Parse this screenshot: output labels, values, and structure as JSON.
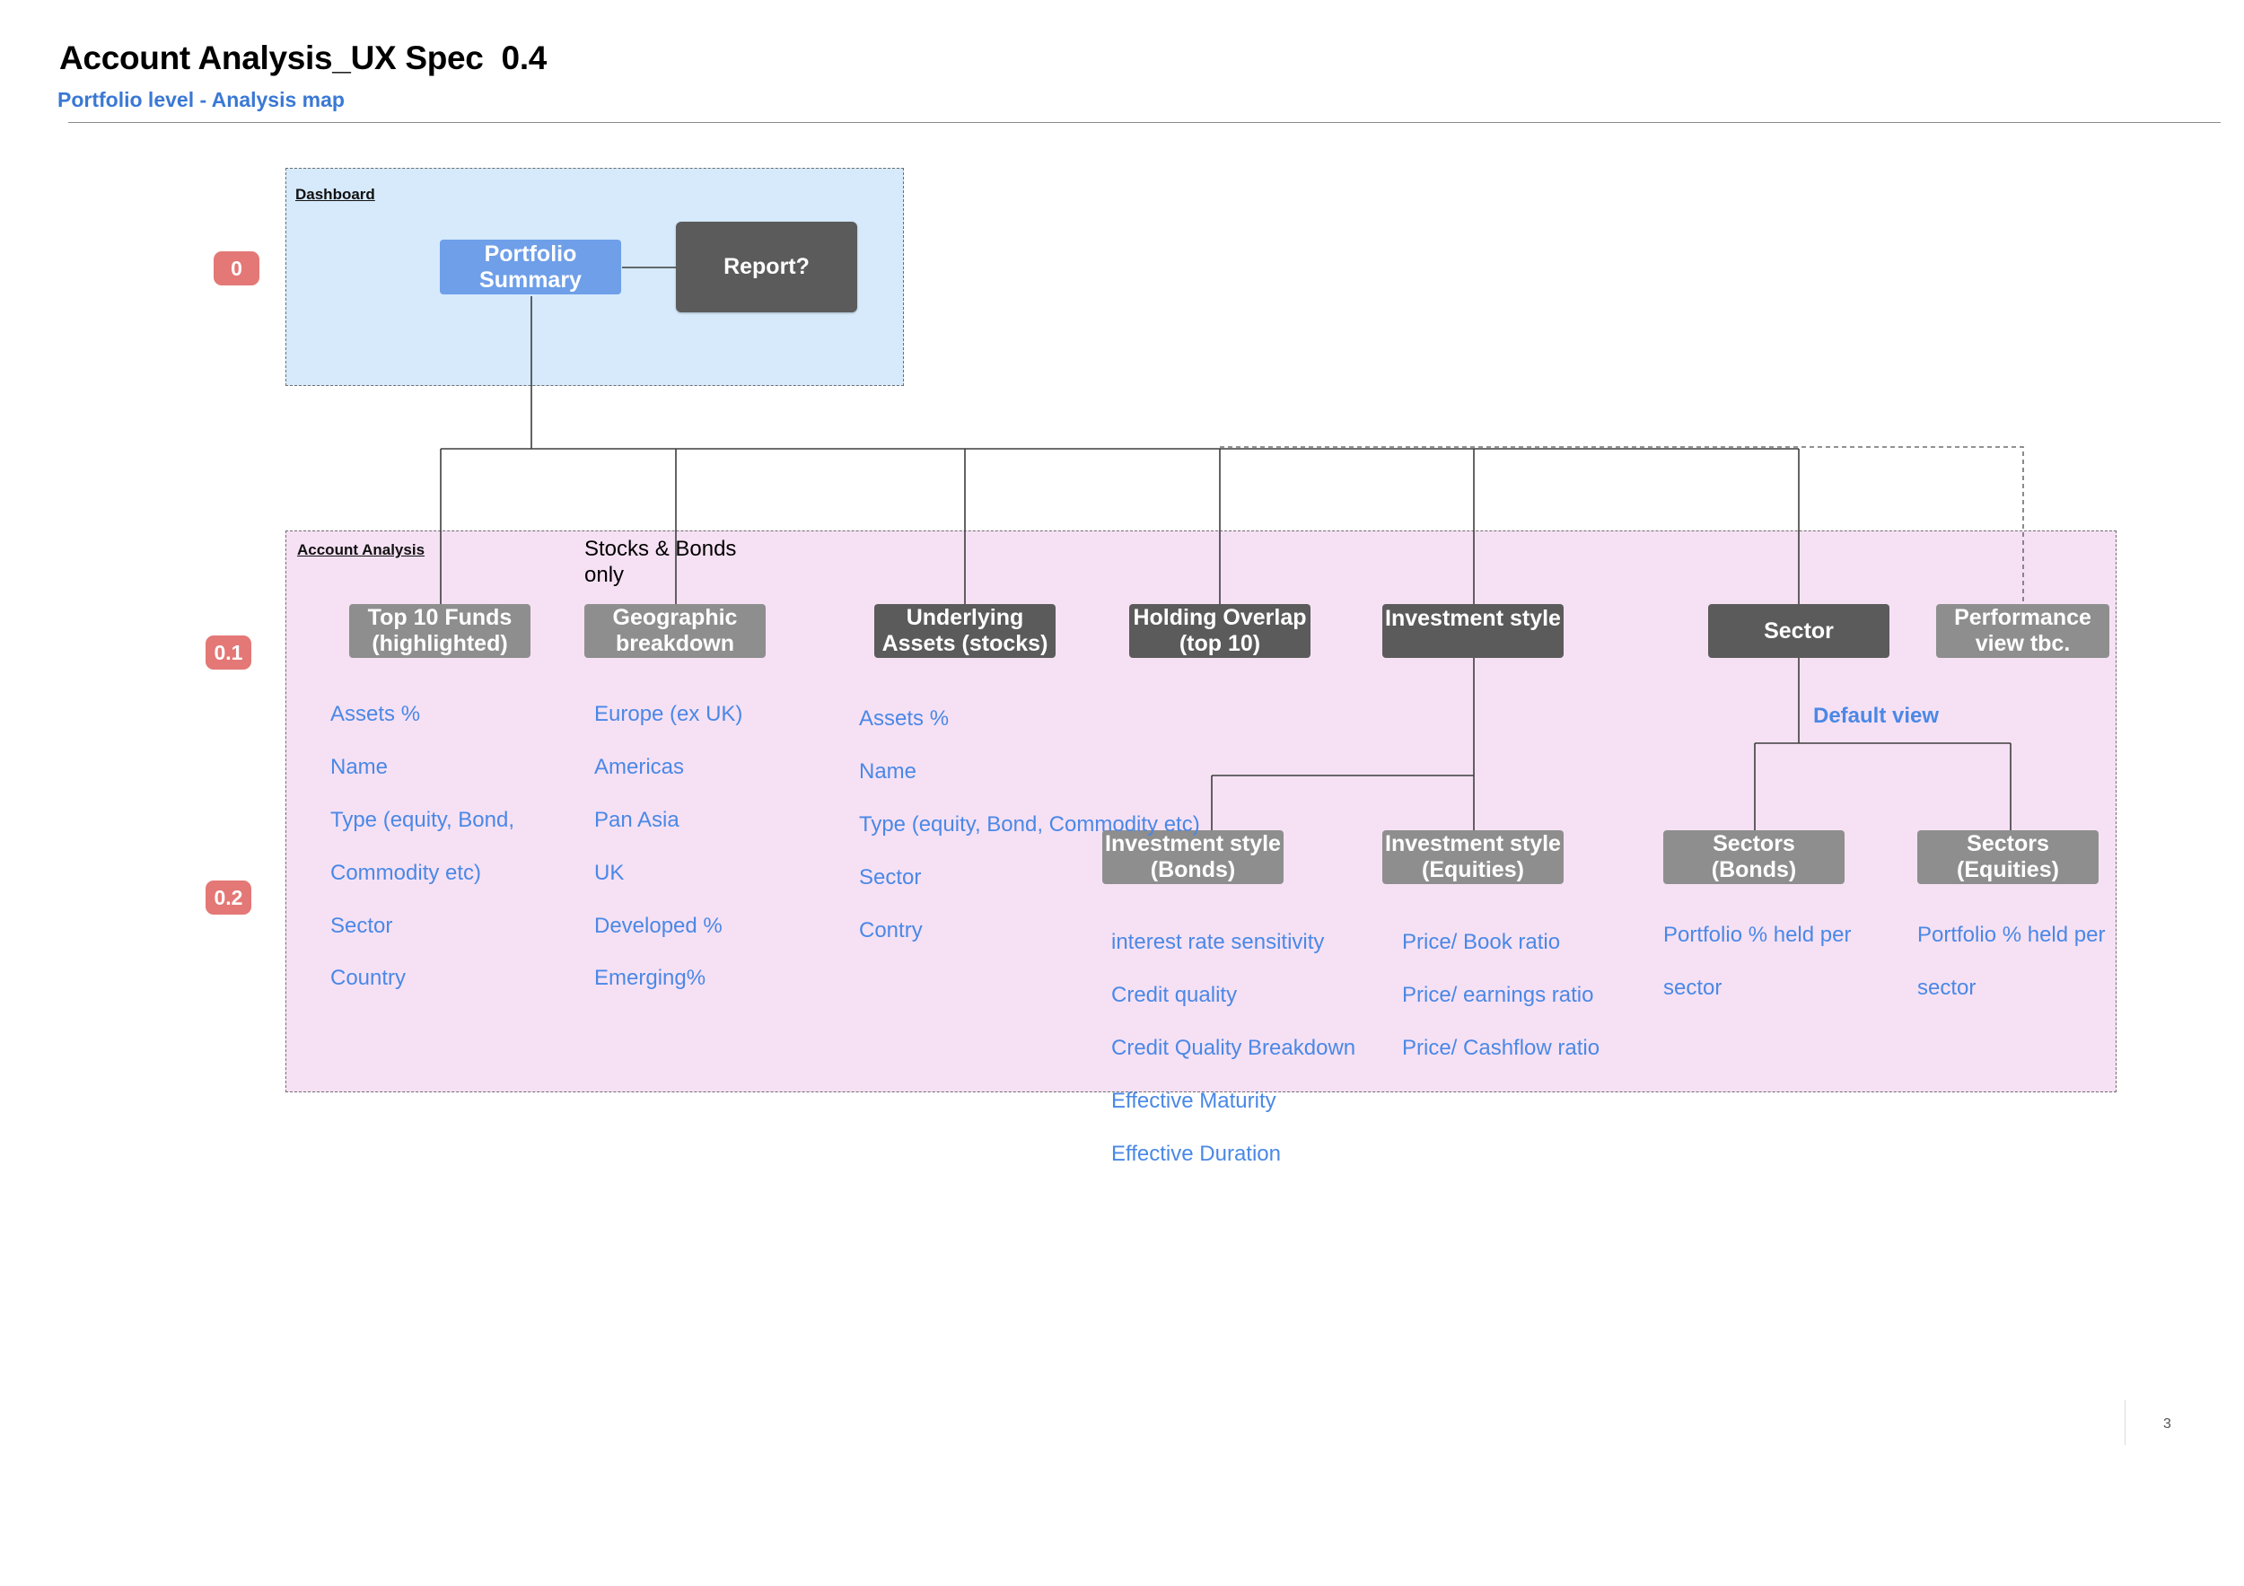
{
  "header": {
    "title": "Account Analysis_UX Spec  0.4",
    "subtitle": "Portfolio level - Analysis map"
  },
  "regions": {
    "dashboard": "Dashboard",
    "account_analysis": "Account Analysis"
  },
  "levels": [
    "0",
    "0.1",
    "0.2"
  ],
  "nodes": {
    "portfolio_summary": "Portfolio\nSummary",
    "report": "Report?",
    "top10_funds": "Top 10 Funds\n(highlighted)",
    "geographic": "Geographic\nbreakdown",
    "underlying": "Underlying\nAssets (stocks)",
    "holding_overlap": "Holding Overlap\n(top 10)",
    "investment_style": "Investment style",
    "sector": "Sector",
    "performance": "Performance\nview tbc.",
    "inv_style_bonds": "Investment style\n(Bonds)",
    "inv_style_equities": "Investment style\n(Equities)",
    "sectors_bonds": "Sectors\n(Bonds)",
    "sectors_equities": "Sectors\n(Equities)"
  },
  "notes": {
    "stocks_bonds_only": "Stocks & Bonds\nonly",
    "default_view": "Default view"
  },
  "lists": {
    "top10_funds": [
      "Assets %",
      "Name",
      "Type (equity, Bond,",
      "Commodity etc)",
      "Sector",
      "Country"
    ],
    "geographic": [
      "Europe (ex UK)",
      "Americas",
      "Pan Asia",
      "UK",
      "Developed %",
      "Emerging%"
    ],
    "underlying": [
      "Assets %",
      "Name",
      "Type (equity, Bond, Commodity etc)",
      "Sector",
      "Contry"
    ],
    "inv_style_bonds": [
      "interest rate sensitivity",
      "Credit quality",
      "Credit Quality Breakdown",
      "Effective Maturity",
      "Effective Duration"
    ],
    "inv_style_equities": [
      "Price/ Book ratio",
      "Price/ earnings ratio",
      "Price/ Cashflow ratio"
    ],
    "sectors_bonds": [
      "Portfolio % held per",
      "sector"
    ],
    "sectors_equities": [
      "Portfolio % held per",
      "sector"
    ]
  },
  "footer": {
    "page_number": "3"
  },
  "colors": {
    "dashboard_fill": "#d6eafc",
    "analysis_fill": "#f6e1f4",
    "level_badge": "#e37876",
    "node_dark": "#5b5b5b",
    "node_mid": "#8e8e8e",
    "node_blue": "#6e9fe8",
    "list_text": "#4a88e6"
  }
}
